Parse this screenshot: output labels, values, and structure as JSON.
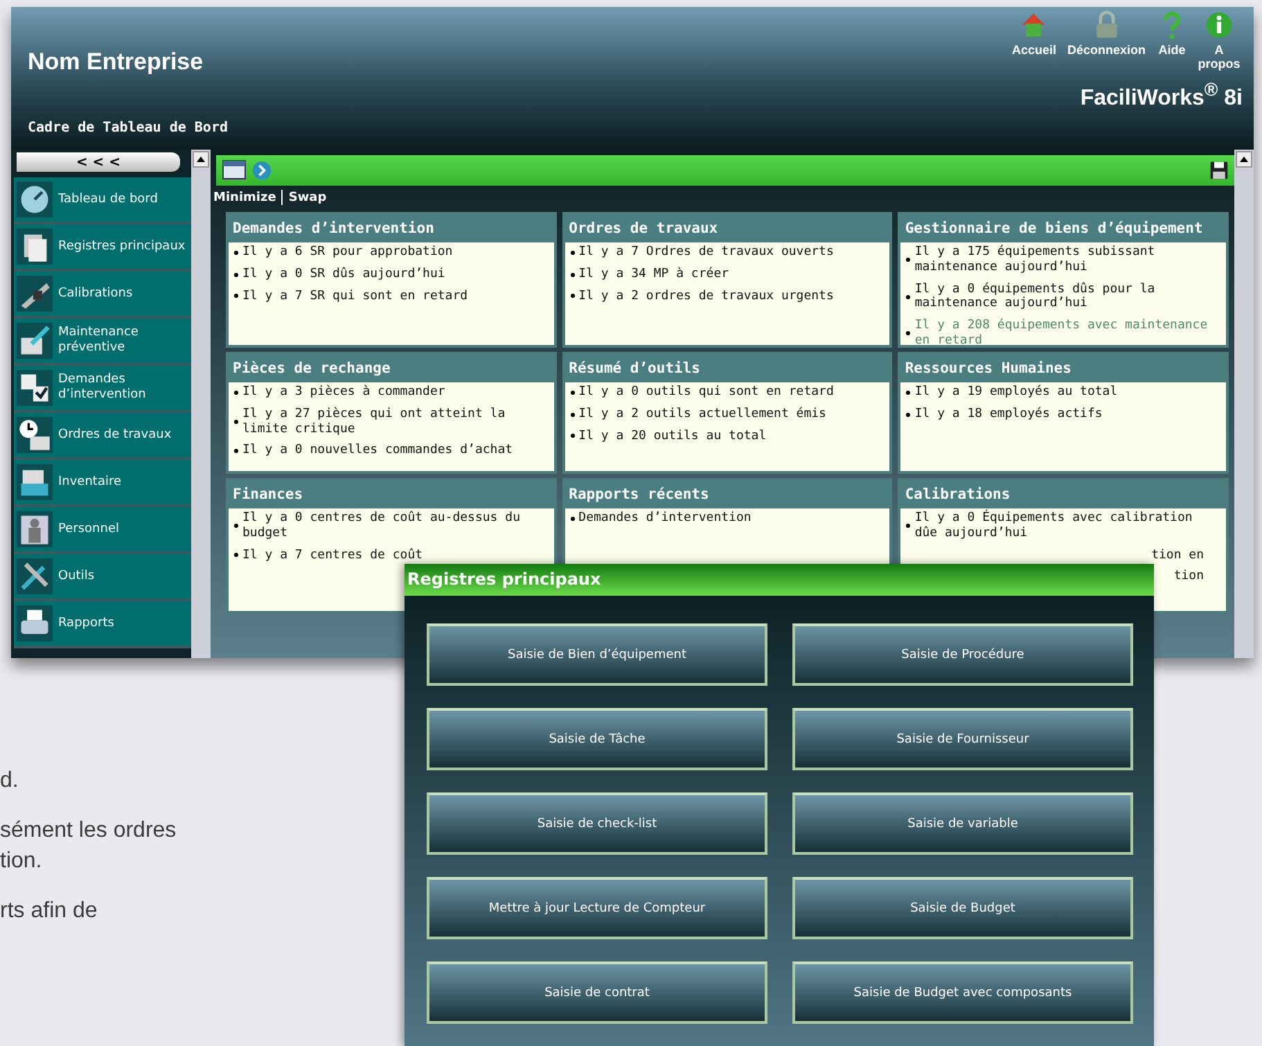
{
  "header": {
    "company": "Nom Entreprise",
    "subtitle": "Cadre de Tableau de Bord",
    "product": "FaciliWorks$^{®}$ 8i",
    "nav": [
      {
        "kind": "home",
        "label": "Accueil"
      },
      {
        "kind": "lock",
        "label": "Déconnexion"
      },
      {
        "kind": "help",
        "label": "Aide"
      },
      {
        "kind": "info",
        "label": "A propos"
      }
    ]
  },
  "sidebar": {
    "collapse": "< < <",
    "items": [
      {
        "kind": "dashboard",
        "label": "Tableau de bord"
      },
      {
        "kind": "records",
        "label": "Registres principaux"
      },
      {
        "kind": "calibration",
        "label": "Calibrations"
      },
      {
        "kind": "preventive",
        "label": "Maintenance préventive"
      },
      {
        "kind": "requests",
        "label": "Demandes d’intervention"
      },
      {
        "kind": "workorders",
        "label": "Ordres de travaux"
      },
      {
        "kind": "inventory",
        "label": "Inventaire"
      },
      {
        "kind": "personnel",
        "label": "Personnel"
      },
      {
        "kind": "tools",
        "label": "Outils"
      },
      {
        "kind": "reports",
        "label": "Rapports"
      }
    ]
  },
  "toolbar": {
    "links": [
      "Minimize",
      "Swap"
    ]
  },
  "panels": [
    {
      "title": "Demandes d’intervention",
      "items": [
        {
          "kind": "item",
          "text": "Il y a 6 SR pour approbation",
          "muted": false
        },
        {
          "kind": "item",
          "text": "Il y a 0 SR dûs aujourd’hui",
          "muted": false
        },
        {
          "kind": "item",
          "text": "Il y a 7 SR qui sont en retard",
          "muted": false
        }
      ]
    },
    {
      "title": "Ordres de travaux",
      "items": [
        {
          "kind": "item",
          "text": "Il y a 7 Ordres de travaux ouverts",
          "muted": false
        },
        {
          "kind": "item",
          "text": "Il y a 34 MP à créer",
          "muted": false
        },
        {
          "kind": "item",
          "text": "Il y a 2 ordres de travaux urgents",
          "muted": false
        }
      ]
    },
    {
      "title": "Gestionnaire de biens d’équipement",
      "items": [
        {
          "kind": "item",
          "text": "Il y a 175 équipements subissant maintenance aujourd’hui",
          "muted": false
        },
        {
          "kind": "item",
          "text": "Il y a 0 équipements dûs pour la maintenance aujourd’hui",
          "muted": false
        },
        {
          "kind": "item",
          "text": "Il y a 208 équipements avec maintenance en retard",
          "muted": true
        }
      ]
    },
    {
      "title": "Pièces de rechange",
      "items": [
        {
          "kind": "item",
          "text": "Il y a 3 pièces à commander",
          "muted": false
        },
        {
          "kind": "item",
          "text": "Il y a 27 pièces qui ont atteint la limite critique",
          "muted": false
        },
        {
          "kind": "item",
          "text": "Il y a 0 nouvelles commandes d’achat",
          "muted": false
        }
      ]
    },
    {
      "title": "Résumé d’outils",
      "items": [
        {
          "kind": "item",
          "text": "Il y a 0 outils qui sont en retard",
          "muted": false
        },
        {
          "kind": "item",
          "text": "Il y a 2 outils actuellement émis",
          "muted": false
        },
        {
          "kind": "item",
          "text": "Il y a 20 outils au total",
          "muted": false
        }
      ]
    },
    {
      "title": "Ressources Humaines",
      "items": [
        {
          "kind": "item",
          "text": "Il y a 19 employés au total",
          "muted": false
        },
        {
          "kind": "item",
          "text": "Il y a 18 employés actifs",
          "muted": false
        }
      ]
    },
    {
      "title": "Finances",
      "items": [
        {
          "kind": "item",
          "text": "Il y a 0 centres de coût au-dessus du budget",
          "muted": false
        },
        {
          "kind": "item",
          "text": "Il y a 7 centres de coût",
          "muted": false
        }
      ]
    },
    {
      "title": "Rapports récents",
      "items": [
        {
          "kind": "item",
          "text": "Demandes d’intervention",
          "muted": false
        }
      ]
    },
    {
      "title": "Calibrations",
      "items": [
        {
          "kind": "item",
          "text": "Il y a 0 Équipements avec calibration dûe aujourd’hui",
          "muted": false
        },
        {
          "kind": "fragment",
          "text": "tion en",
          "muted": false
        },
        {
          "kind": "fragment",
          "text": "tion",
          "muted": false
        }
      ]
    }
  ],
  "dialog": {
    "title": "Registres principaux",
    "buttons": [
      "Saisie de Bien d’équipement",
      "Saisie de Procédure",
      "Saisie de Tâche",
      "Saisie de Fournisseur",
      "Saisie de check-list",
      "Saisie de variable",
      "Mettre à jour Lecture de Compteur",
      "Saisie de Budget",
      "Saisie de contrat",
      "Saisie de Budget avec composants"
    ]
  },
  "background_paragraphs": [
    {
      "lines": [
        "d."
      ]
    },
    {
      "lines": [
        "sément les ordres",
        "tion."
      ]
    },
    {
      "lines": [
        "rts afin de"
      ]
    }
  ]
}
